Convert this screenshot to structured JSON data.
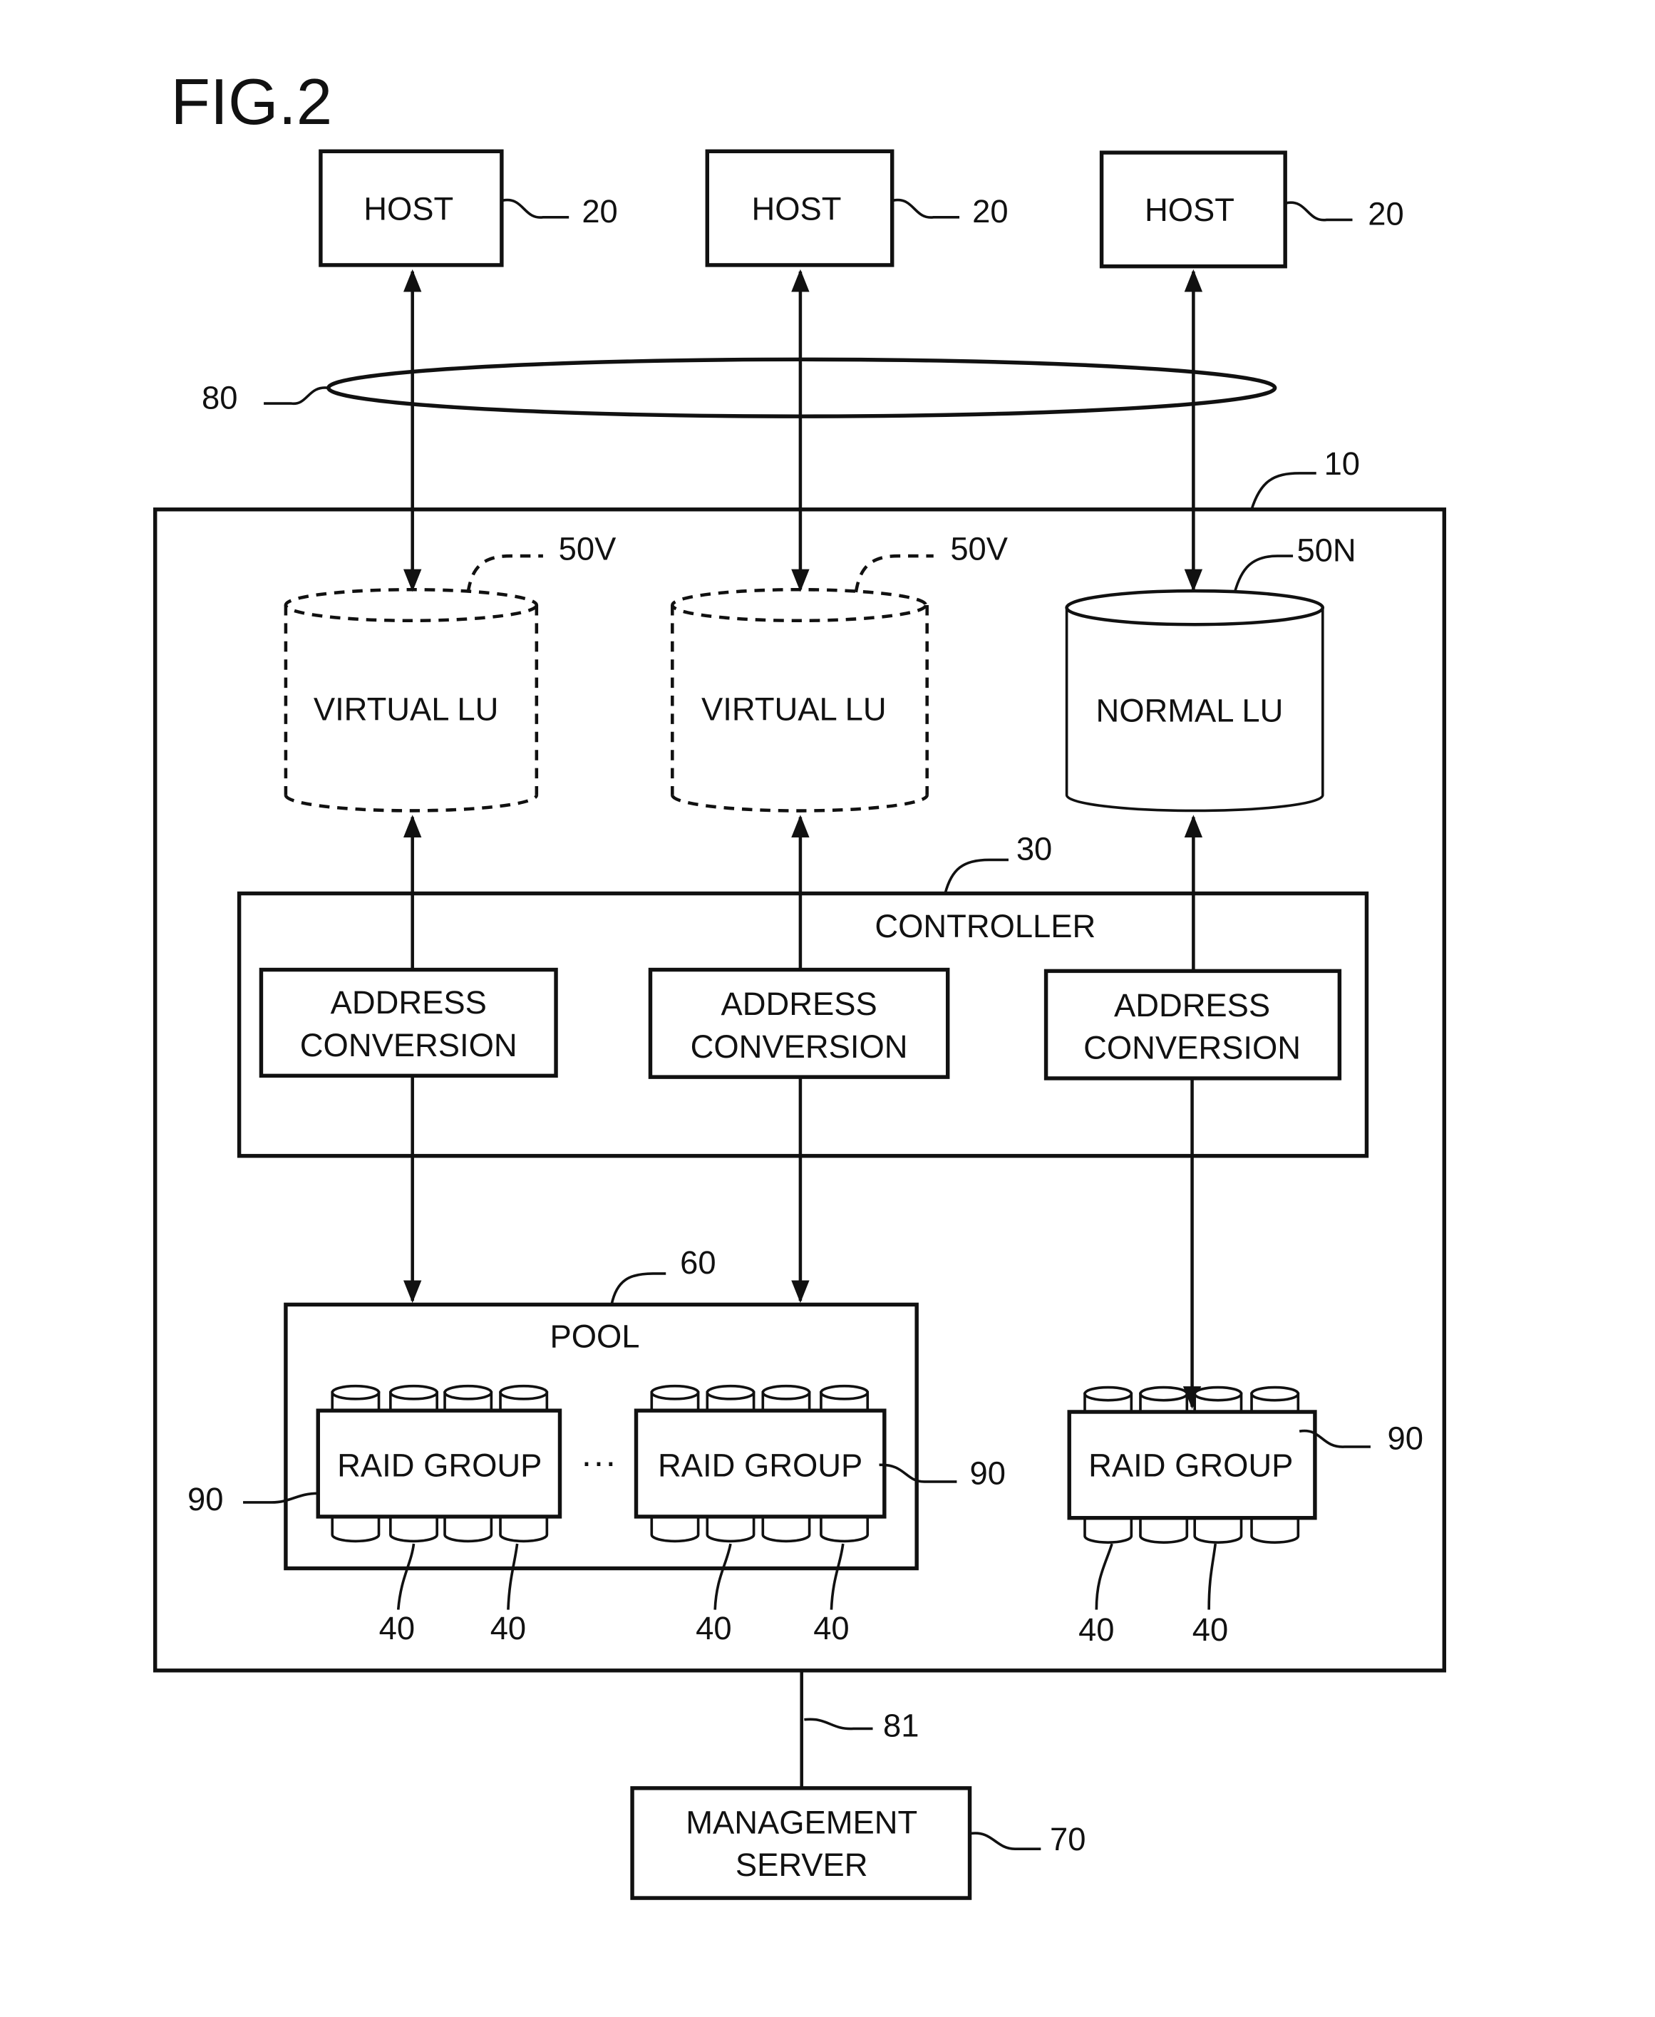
{
  "figure": {
    "title": "FIG.2"
  },
  "hosts": [
    {
      "label": "HOST",
      "ref": "20"
    },
    {
      "label": "HOST",
      "ref": "20"
    },
    {
      "label": "HOST",
      "ref": "20"
    }
  ],
  "network": {
    "ref": "80"
  },
  "storage_system": {
    "ref": "10"
  },
  "logical_units": [
    {
      "label": "VIRTUAL LU",
      "ref": "50V",
      "type": "virtual"
    },
    {
      "label": "VIRTUAL LU",
      "ref": "50V",
      "type": "virtual"
    },
    {
      "label": "NORMAL LU",
      "ref": "50N",
      "type": "normal"
    }
  ],
  "controller": {
    "label": "CONTROLLER",
    "ref": "30",
    "units": [
      {
        "line1": "ADDRESS",
        "line2": "CONVERSION"
      },
      {
        "line1": "ADDRESS",
        "line2": "CONVERSION"
      },
      {
        "line1": "ADDRESS",
        "line2": "CONVERSION"
      }
    ]
  },
  "pool": {
    "label": "POOL",
    "ref": "60",
    "ellipsis": "···"
  },
  "raid_groups": [
    {
      "label": "RAID GROUP",
      "ref": "90",
      "disk_refs": [
        "40",
        "40"
      ]
    },
    {
      "label": "RAID GROUP",
      "ref": "90",
      "disk_refs": [
        "40",
        "40"
      ]
    },
    {
      "label": "RAID GROUP",
      "ref": "90",
      "disk_refs": [
        "40",
        "40"
      ]
    }
  ],
  "management_link": {
    "ref": "81"
  },
  "management_server": {
    "line1": "MANAGEMENT",
    "line2": "SERVER",
    "ref": "70"
  }
}
